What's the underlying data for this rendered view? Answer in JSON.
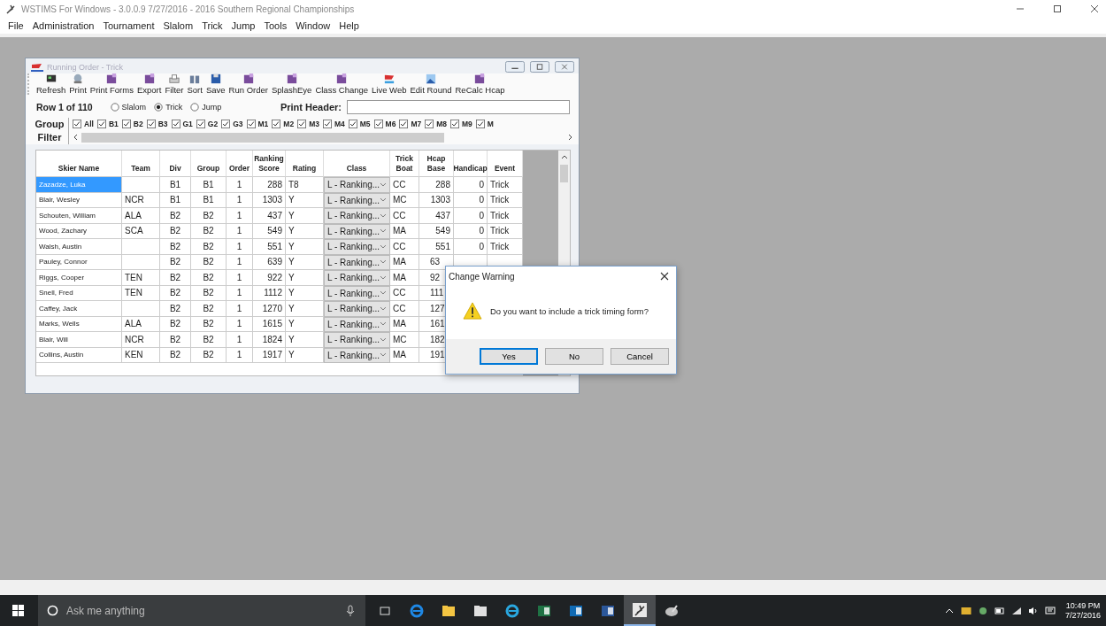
{
  "app_window": {
    "title": "WSTIMS For Windows - 3.0.0.9 7/27/2016 - 2016 Southern Regional Championships"
  },
  "menu": [
    "File",
    "Administration",
    "Tournament",
    "Slalom",
    "Trick",
    "Jump",
    "Tools",
    "Window",
    "Help"
  ],
  "child_window": {
    "title": "Running Order - Trick",
    "toolbar": [
      {
        "label": "Refresh",
        "kind": "monitor"
      },
      {
        "label": "Print",
        "kind": "globe"
      },
      {
        "label": "Print Forms",
        "kind": "app"
      },
      {
        "label": "Export",
        "kind": "app"
      },
      {
        "label": "Filter",
        "kind": "printer"
      },
      {
        "label": "Sort",
        "kind": "binoculars"
      },
      {
        "label": "Save",
        "kind": "disk"
      },
      {
        "label": "Run Order",
        "kind": "app"
      },
      {
        "label": "SplashEye",
        "kind": "app"
      },
      {
        "label": "Class Change",
        "kind": "app"
      },
      {
        "label": "Live Web",
        "kind": "flag"
      },
      {
        "label": "Edit Round",
        "kind": "picture"
      },
      {
        "label": "ReCalc Hcap",
        "kind": "app"
      }
    ],
    "row_status": "Row 1 of 110",
    "events": [
      {
        "label": "Slalom",
        "selected": false
      },
      {
        "label": "Trick",
        "selected": true
      },
      {
        "label": "Jump",
        "selected": false
      }
    ],
    "print_header": {
      "label": "Print Header:"
    },
    "group_filter": {
      "label": "Group Filter",
      "groups": [
        {
          "label": "All",
          "checked": true
        },
        {
          "label": "B1",
          "checked": true
        },
        {
          "label": "B2",
          "checked": true
        },
        {
          "label": "B3",
          "checked": true
        },
        {
          "label": "G1",
          "checked": true
        },
        {
          "label": "G2",
          "checked": true
        },
        {
          "label": "G3",
          "checked": true
        },
        {
          "label": "M1",
          "checked": true
        },
        {
          "label": "M2",
          "checked": true
        },
        {
          "label": "M3",
          "checked": true
        },
        {
          "label": "M4",
          "checked": true
        },
        {
          "label": "M5",
          "checked": true
        },
        {
          "label": "M6",
          "checked": true
        },
        {
          "label": "M7",
          "checked": true
        },
        {
          "label": "M8",
          "checked": true
        },
        {
          "label": "M9",
          "checked": true
        },
        {
          "label": "M",
          "checked": true
        }
      ]
    },
    "table": {
      "columns": [
        "Skier Name",
        "Team",
        "Div",
        "Group",
        "Order",
        "Ranking Score",
        "Rating",
        "Class",
        "Trick Boat",
        "Hcap Base",
        "Handicap",
        "Event"
      ],
      "rows": [
        {
          "name": "Zazadze, Luka",
          "div": "B1",
          "group": "B1",
          "order": "1",
          "score": "288",
          "rating": "T8",
          "class": "L - Ranking...",
          "boat": "CC",
          "hcap_base": "288",
          "handicap": "0",
          "event": "Trick",
          "selected": true
        },
        {
          "name": "Blair, Wesley",
          "team": "NCR",
          "div": "B1",
          "group": "B1",
          "order": "1",
          "score": "1303",
          "rating": "Y",
          "class": "L - Ranking...",
          "boat": "MC",
          "hcap_base": "1303",
          "handicap": "0",
          "event": "Trick",
          "selected": false
        },
        {
          "name": "Schouten, William",
          "team": "ALA",
          "div": "B2",
          "group": "B2",
          "order": "1",
          "score": "437",
          "rating": "Y",
          "class": "L - Ranking...",
          "boat": "CC",
          "hcap_base": "437",
          "handicap": "0",
          "event": "Trick",
          "selected": false
        },
        {
          "name": "Wood, Zachary",
          "team": "SCA",
          "div": "B2",
          "group": "B2",
          "order": "1",
          "score": "549",
          "rating": "Y",
          "class": "L - Ranking...",
          "boat": "MA",
          "hcap_base": "549",
          "handicap": "0",
          "event": "Trick",
          "selected": false
        },
        {
          "name": "Walsh, Austin",
          "div": "B2",
          "group": "B2",
          "order": "1",
          "score": "551",
          "rating": "Y",
          "class": "L - Ranking...",
          "boat": "CC",
          "hcap_base": "551",
          "handicap": "0",
          "event": "Trick",
          "selected": false
        },
        {
          "name": "Pauley, Connor",
          "div": "B2",
          "group": "B2",
          "order": "1",
          "score": "639",
          "rating": "Y",
          "class": "L - Ranking...",
          "boat": "MA",
          "hcap_base": "63",
          "selected": false
        },
        {
          "name": "Riggs, Cooper",
          "team": "TEN",
          "div": "B2",
          "group": "B2",
          "order": "1",
          "score": "922",
          "rating": "Y",
          "class": "L - Ranking...",
          "boat": "MA",
          "hcap_base": "92",
          "selected": false
        },
        {
          "name": "Snell, Fred",
          "team": "TEN",
          "div": "B2",
          "group": "B2",
          "order": "1",
          "score": "1112",
          "rating": "Y",
          "class": "L - Ranking...",
          "boat": "CC",
          "hcap_base": "111",
          "selected": false
        },
        {
          "name": "Caffey, Jack",
          "div": "B2",
          "group": "B2",
          "order": "1",
          "score": "1270",
          "rating": "Y",
          "class": "L - Ranking...",
          "boat": "CC",
          "hcap_base": "127",
          "selected": false
        },
        {
          "name": "Marks, Wells",
          "team": "ALA",
          "div": "B2",
          "group": "B2",
          "order": "1",
          "score": "1615",
          "rating": "Y",
          "class": "L - Ranking...",
          "boat": "MA",
          "hcap_base": "161",
          "selected": false
        },
        {
          "name": "Blair, Will",
          "team": "NCR",
          "div": "B2",
          "group": "B2",
          "order": "1",
          "score": "1824",
          "rating": "Y",
          "class": "L - Ranking...",
          "boat": "MC",
          "hcap_base": "182",
          "selected": false
        },
        {
          "name": "Collins, Austin",
          "team": "KEN",
          "div": "B2",
          "group": "B2",
          "order": "1",
          "score": "1917",
          "rating": "Y",
          "class": "L - Ranking...",
          "boat": "MA",
          "hcap_base": "191",
          "selected": false
        }
      ]
    }
  },
  "dialog": {
    "title": "Change Warning",
    "message": "Do you want to include a trick timing form?",
    "buttons": [
      {
        "label": "Yes",
        "selected": true
      },
      {
        "label": "No",
        "selected": false
      },
      {
        "label": "Cancel",
        "selected": false
      }
    ]
  },
  "taskbar": {
    "search": {
      "placeholder": "Ask me anything"
    },
    "apps": [
      {
        "kind": "taskview"
      },
      {
        "kind": "edge"
      },
      {
        "kind": "folder"
      },
      {
        "kind": "store"
      },
      {
        "kind": "ie"
      },
      {
        "kind": "excel"
      },
      {
        "kind": "outlook"
      },
      {
        "kind": "word"
      },
      {
        "kind": "wstims",
        "selected": true
      },
      {
        "kind": "paint"
      }
    ],
    "time": "10:49 PM",
    "date": "7/27/2016"
  }
}
